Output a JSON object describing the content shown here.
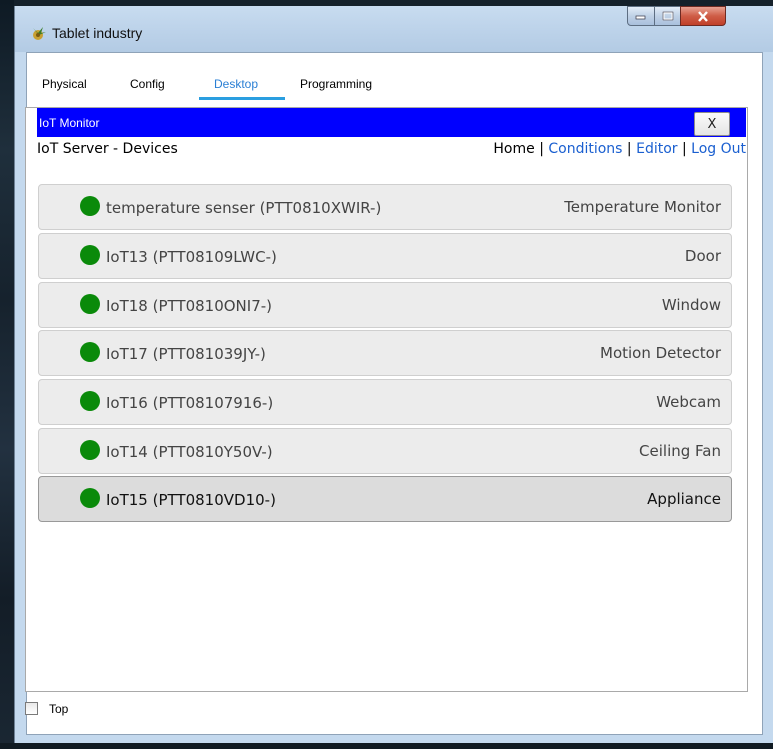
{
  "window": {
    "title": "Tablet industry",
    "controls": {
      "minimize": "minimize-icon",
      "maximize": "maximize-icon",
      "close": "close-icon"
    }
  },
  "tabs": [
    {
      "label": "Physical",
      "active": false
    },
    {
      "label": "Config",
      "active": false
    },
    {
      "label": "Desktop",
      "active": true
    },
    {
      "label": "Programming",
      "active": false
    }
  ],
  "monitor": {
    "title": "IoT Monitor",
    "close_label": "X",
    "header": "IoT Server - Devices",
    "nav": {
      "home": "Home",
      "conditions": "Conditions",
      "editor": "Editor",
      "logout": "Log Out",
      "separator": "|"
    }
  },
  "devices": [
    {
      "name": "temperature senser (PTT0810XWIR-)",
      "type": "Temperature Monitor",
      "status_color": "#0a8a0a"
    },
    {
      "name": "IoT13 (PTT08109LWC-)",
      "type": "Door",
      "status_color": "#0a8a0a"
    },
    {
      "name": "IoT18 (PTT0810ONI7-)",
      "type": "Window",
      "status_color": "#0a8a0a"
    },
    {
      "name": "IoT17 (PTT081039JY-)",
      "type": "Motion Detector",
      "status_color": "#0a8a0a"
    },
    {
      "name": "IoT16 (PTT08107916-)",
      "type": "Webcam",
      "status_color": "#0a8a0a"
    },
    {
      "name": "IoT14 (PTT0810Y50V-)",
      "type": "Ceiling Fan",
      "status_color": "#0a8a0a"
    },
    {
      "name": "IoT15 (PTT0810VD10-)",
      "type": "Appliance",
      "status_color": "#0a8a0a",
      "selected": true
    }
  ],
  "footer": {
    "top_label": "Top",
    "top_checked": false
  },
  "colors": {
    "monitor_bar": "#0000ff",
    "link": "#1a5fd0",
    "active_tab": "#2a7fd4",
    "status_online": "#0a8a0a"
  }
}
